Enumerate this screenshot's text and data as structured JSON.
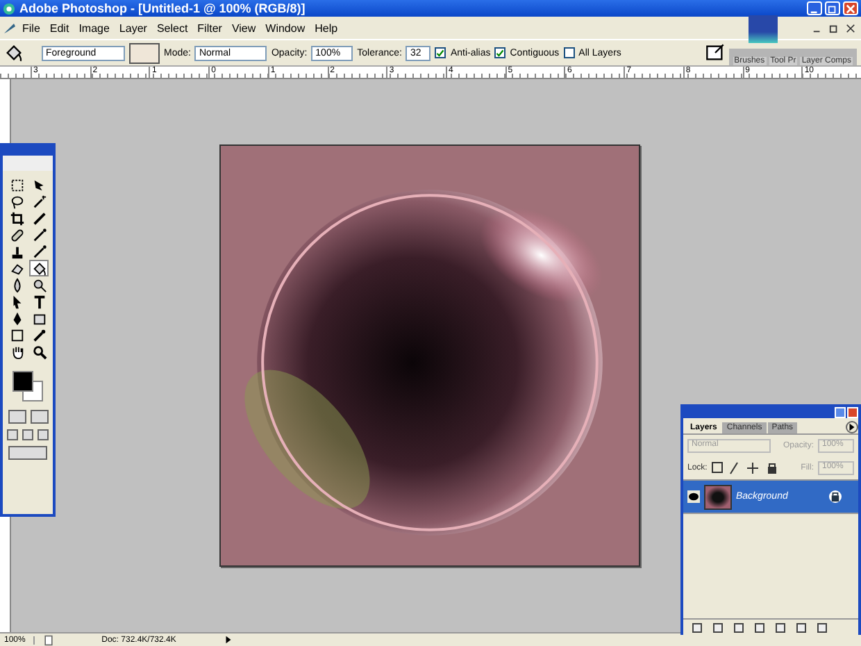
{
  "window": {
    "title": "Adobe Photoshop - [Untitled-1 @ 100% (RGB/8)]"
  },
  "menu": [
    "File",
    "Edit",
    "Image",
    "Layer",
    "Select",
    "Filter",
    "View",
    "Window",
    "Help"
  ],
  "options": {
    "fill_source": "Foreground",
    "mode_label": "Mode:",
    "mode": "Normal",
    "opacity_label": "Opacity:",
    "opacity": "100%",
    "tolerance_label": "Tolerance:",
    "tolerance": "32",
    "checks": [
      {
        "label": "Anti-alias",
        "checked": true
      },
      {
        "label": "Contiguous",
        "checked": true
      },
      {
        "label": "All Layers",
        "checked": false
      }
    ]
  },
  "palette_well": [
    "Brushes",
    "Tool Pr",
    "Layer Comps"
  ],
  "ruler": [
    "3",
    "2",
    "1",
    "0",
    "1",
    "2",
    "3",
    "4",
    "5",
    "6",
    "7",
    "8",
    "9",
    "10"
  ],
  "tools": [
    {
      "kind": "marquee",
      "selected": false
    },
    {
      "kind": "move",
      "selected": false
    },
    {
      "kind": "lasso",
      "selected": false
    },
    {
      "kind": "wand",
      "selected": false
    },
    {
      "kind": "crop",
      "selected": false
    },
    {
      "kind": "slice",
      "selected": false
    },
    {
      "kind": "bandage",
      "selected": false
    },
    {
      "kind": "brush",
      "selected": false
    },
    {
      "kind": "stamp",
      "selected": false
    },
    {
      "kind": "brush",
      "selected": false
    },
    {
      "kind": "eraser",
      "selected": false
    },
    {
      "kind": "bucket",
      "selected": true
    },
    {
      "kind": "drop",
      "selected": false
    },
    {
      "kind": "dodge",
      "selected": false
    },
    {
      "kind": "arrow",
      "selected": false
    },
    {
      "kind": "type",
      "selected": false
    },
    {
      "kind": "pen",
      "selected": false
    },
    {
      "kind": "shape",
      "selected": false
    },
    {
      "kind": "note",
      "selected": false
    },
    {
      "kind": "eyedropper",
      "selected": false
    },
    {
      "kind": "hand",
      "selected": false
    },
    {
      "kind": "zoom",
      "selected": false
    }
  ],
  "layers_panel": {
    "tabs": [
      {
        "label": "Layers",
        "selected": true
      },
      {
        "label": "Channels",
        "selected": false
      },
      {
        "label": "Paths",
        "selected": false
      }
    ],
    "blend": "Normal",
    "opacity_label": "Opacity:",
    "opacity": "100%",
    "lock_label": "Lock:",
    "fill_label": "Fill:",
    "fill": "100%",
    "layers": [
      {
        "name": "Background",
        "visible": true,
        "selected": true,
        "locked": true
      }
    ]
  },
  "status_bar": {
    "zoom": "100%",
    "doc": "Doc: 732.4K/732.4K"
  }
}
